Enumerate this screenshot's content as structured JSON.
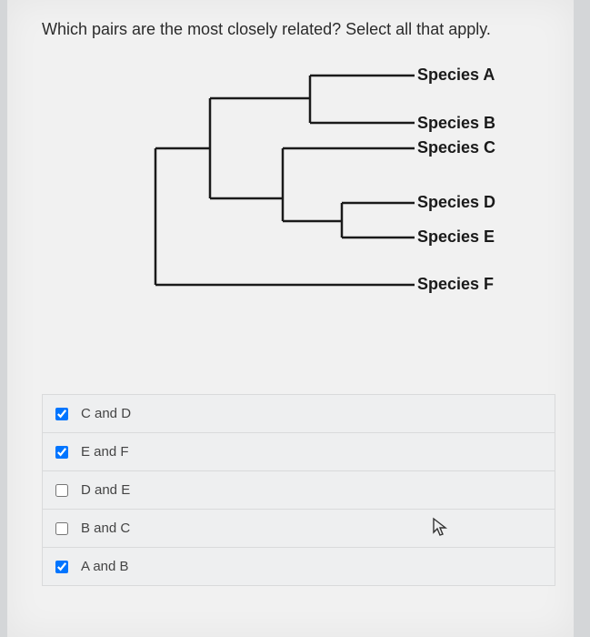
{
  "question": "Which pairs are the most closely related? Select all that apply.",
  "species": {
    "a": "Species A",
    "b": "Species B",
    "c": "Species C",
    "d": "Species D",
    "e": "Species E",
    "f": "Species F"
  },
  "options": [
    {
      "label": "C and D",
      "checked": true
    },
    {
      "label": "E and F",
      "checked": true
    },
    {
      "label": "D and E",
      "checked": false
    },
    {
      "label": "B and C",
      "checked": false
    },
    {
      "label": "A and B",
      "checked": true
    }
  ],
  "chart_data": {
    "type": "table",
    "title": "Phylogenetic tree (cladogram) structure",
    "structure": "((((A,B),(C,(D,E))),F))",
    "notes": "Leaves are Species A–F. A and B share the most recent node; C joins with (D,E); that clade joins (A,B); F is outgroup."
  }
}
